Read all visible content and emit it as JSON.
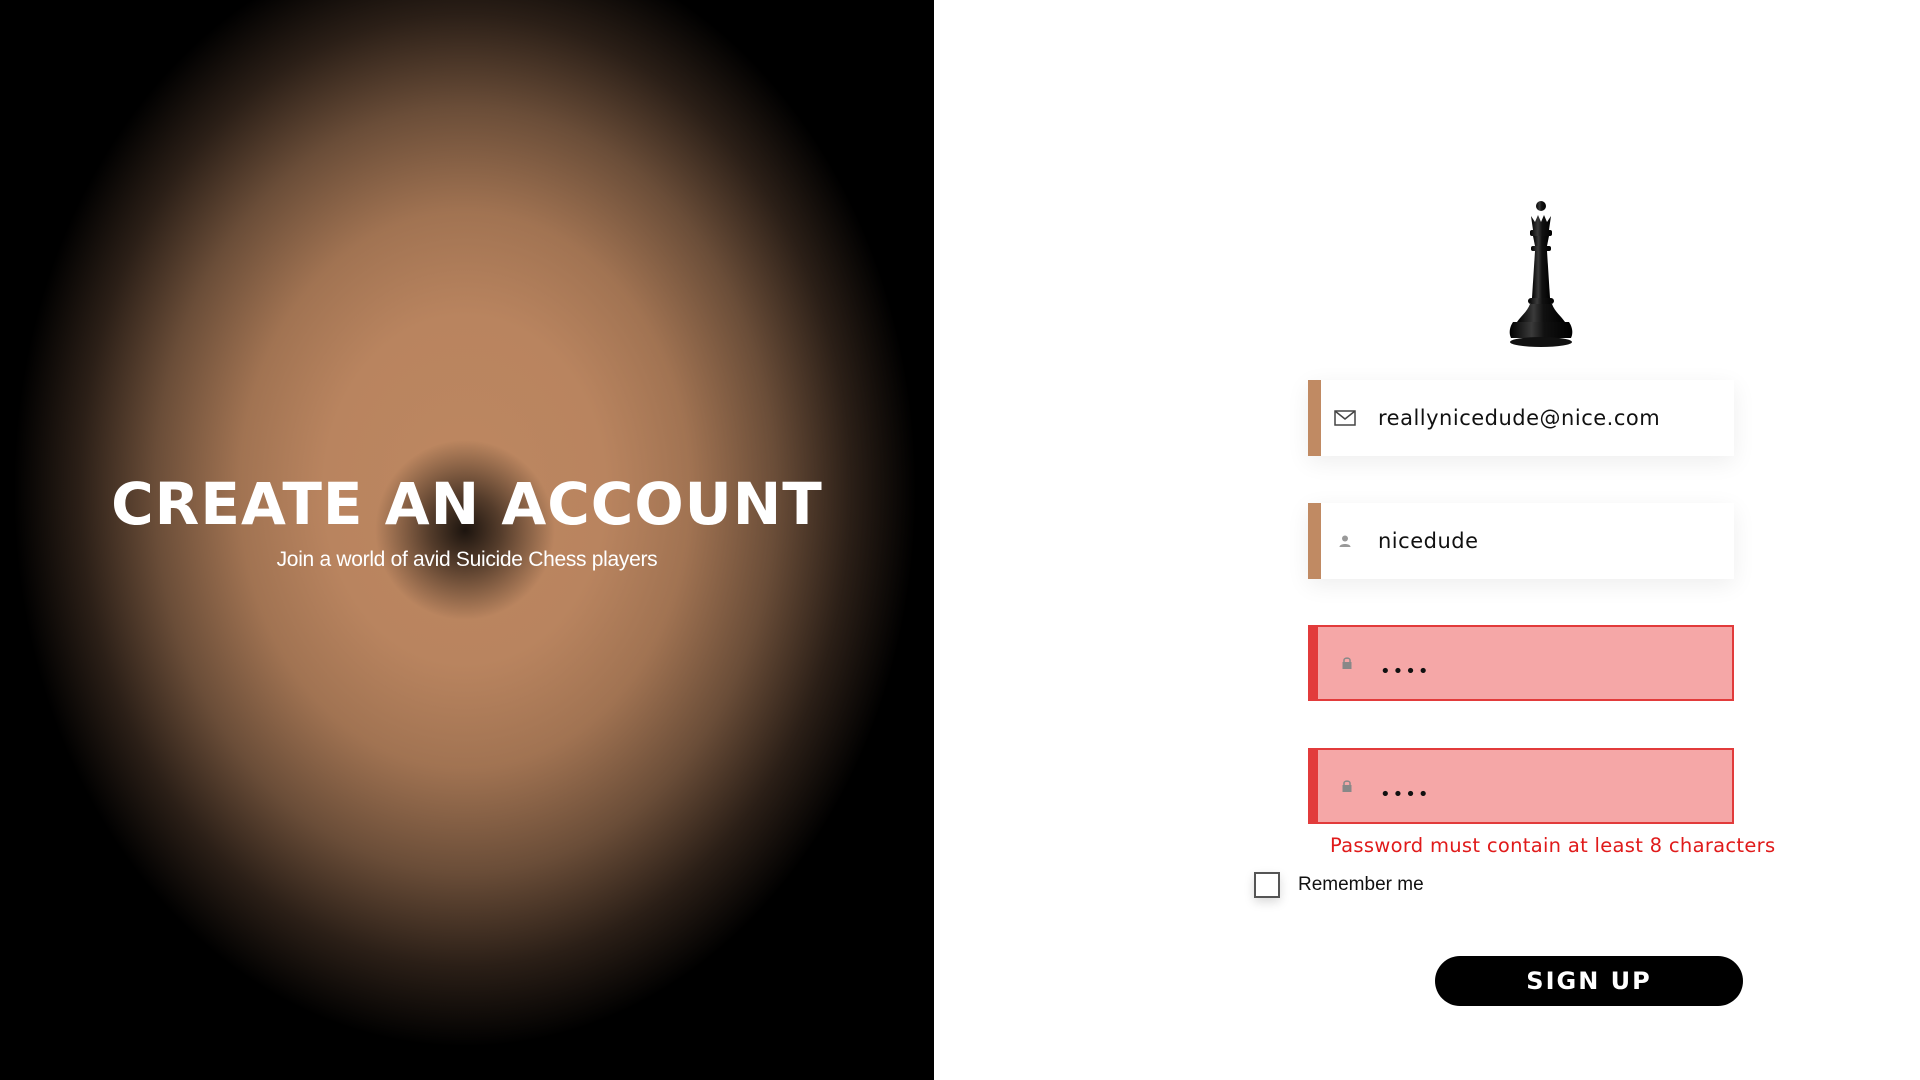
{
  "hero": {
    "title": "CREATE AN ACCOUNT",
    "subtitle": "Join a world of avid Suicide Chess players"
  },
  "logo": {
    "icon": "chess-queen-icon"
  },
  "form": {
    "email": {
      "value": "reallynicedude@nice.com",
      "icon": "envelope-icon"
    },
    "username": {
      "value": "nicedude",
      "icon": "user-icon"
    },
    "password": {
      "value": "••••",
      "icon": "lock-icon",
      "state": "error"
    },
    "confirm_password": {
      "value": "••••",
      "icon": "lock-icon",
      "state": "error"
    },
    "error_message": "Password must contain at least 8 characters",
    "remember_label": "Remember me",
    "remember_checked": false,
    "submit_label": "SIGN UP"
  },
  "colors": {
    "accent": "#c08a63",
    "error": "#e23b3b",
    "error_fill": "#f5a7a7",
    "button": "#000000"
  }
}
